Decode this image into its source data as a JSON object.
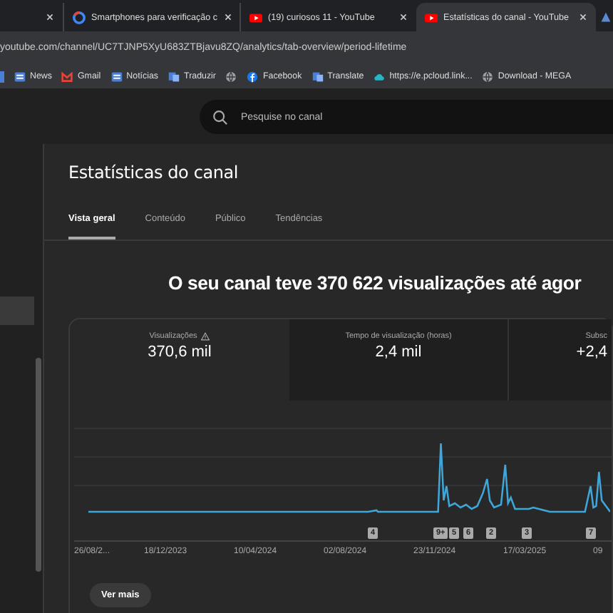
{
  "browser_tabs": [
    {
      "selected": false
    },
    {
      "title": "Smartphones para verificação c",
      "selected": false
    },
    {
      "title": "(19) curiosos 11 - YouTube",
      "selected": false
    },
    {
      "title": "Estatísticas do canal - YouTube",
      "selected": true
    }
  ],
  "address": "youtube.com/channel/UC7TJNP5XyU683ZTBjavu8ZQ/analytics/tab-overview/period-lifetime",
  "bookmarks": [
    {
      "label": "News"
    },
    {
      "label": "Gmail"
    },
    {
      "label": "Notícias"
    },
    {
      "label": "Traduzir"
    },
    {
      "label": "Facebook"
    },
    {
      "label": "Translate"
    },
    {
      "label": "https://e.pcloud.link..."
    },
    {
      "label": "Download - MEGA"
    }
  ],
  "search": {
    "placeholder": "Pesquise no canal"
  },
  "page_title": "Estatísticas do canal",
  "tabs": [
    {
      "label": "Vista geral",
      "selected": true
    },
    {
      "label": "Conteúdo",
      "selected": false
    },
    {
      "label": "Público",
      "selected": false
    },
    {
      "label": "Tendências",
      "selected": false
    }
  ],
  "headline": "O seu canal teve 370 622 visualizações até agor",
  "metrics": [
    {
      "label": "Visualizações",
      "value": "370,6 mil",
      "warning": true,
      "selected": true
    },
    {
      "label": "Tempo de visualização (horas)",
      "value": "2,4 mil",
      "warning": false,
      "selected": false
    },
    {
      "label": "Subsc",
      "value": "+2,4",
      "warning": false,
      "selected": false
    }
  ],
  "markers": [
    "4",
    "9+",
    "5",
    "6",
    "2",
    "3",
    "7"
  ],
  "dates": [
    "26/08/2...",
    "18/12/2023",
    "10/04/2024",
    "02/08/2024",
    "23/11/2024",
    "17/03/2025",
    "09"
  ],
  "more_button": "Ver mais"
}
